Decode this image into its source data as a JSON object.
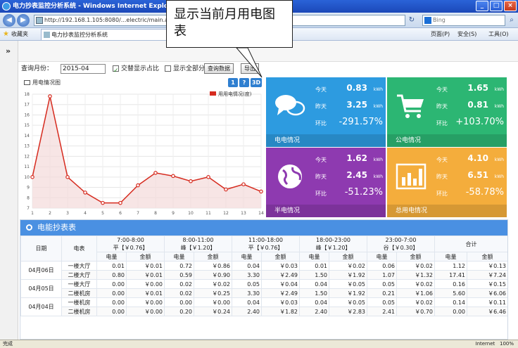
{
  "browser": {
    "title": "电力抄表监控分析系统 - Windows Internet Explorer",
    "address": "http://192.168.1.105:8080/...electric/main.aspx",
    "search_placeholder": "Bing",
    "favorites_label": "收藏夹",
    "tab_label": "电力抄表监控分析系统",
    "page_menu": "页面(P)",
    "safety_menu": "安全(S)",
    "tools_menu": "工具(O)",
    "status_left": "完成",
    "status_zone": "Internet",
    "zoom": "100%"
  },
  "callout": {
    "text": "显示当前月用电图表"
  },
  "toolbar": {
    "month_label": "查询月份：",
    "month_value": "2015-04",
    "chk1_label": "交替显示占比",
    "chk2_label": "显示全部分类",
    "query_button": "查询数据",
    "export_button": "导出"
  },
  "chart": {
    "title": "用电情况图",
    "btn1": "1",
    "btn2": "?",
    "btn3": "3D",
    "legend": "用用电情况(度)"
  },
  "chart_data": {
    "type": "line",
    "title": "用电情况图",
    "x": [
      1,
      2,
      3,
      4,
      5,
      6,
      7,
      8,
      9,
      10,
      11,
      12,
      13,
      14
    ],
    "series": [
      {
        "name": "用用电情况(度)",
        "values": [
          10,
          17.8,
          10,
          8.5,
          7.5,
          7.5,
          9.2,
          10.4,
          10.1,
          9.6,
          10,
          8.8,
          9.3,
          8.6
        ]
      }
    ],
    "ylim": [
      7,
      18
    ],
    "yticks": [
      7,
      8,
      9,
      10,
      11,
      12,
      13,
      14,
      15,
      16,
      17,
      18
    ],
    "grid": true,
    "legend_position": "top-right",
    "colors": {
      "line": "#d62b1f",
      "area": "#f3dada"
    }
  },
  "tiles": [
    {
      "name": "purchase",
      "color": "#2d9be0",
      "icon": "chat-bubbles-icon",
      "today_label": "今天",
      "today_value": "0.83",
      "unit": "kWh",
      "yesterday_label": "昨天",
      "yesterday_value": "3.25",
      "ratio_label": "环比",
      "ratio_value": "-291.57%",
      "footer": "电电情况"
    },
    {
      "name": "public",
      "color": "#2cb673",
      "icon": "shopping-cart-icon",
      "today_label": "今天",
      "today_value": "1.65",
      "unit": "kWh",
      "yesterday_label": "昨天",
      "yesterday_value": "0.81",
      "ratio_label": "环比",
      "ratio_value": "+103.70%",
      "footer": "公电情况"
    },
    {
      "name": "half-month",
      "color": "#8e3ab0",
      "icon": "globe-icon",
      "today_label": "今天",
      "today_value": "1.62",
      "unit": "kWh",
      "yesterday_label": "昨天",
      "yesterday_value": "2.45",
      "ratio_label": "环比",
      "ratio_value": "-51.23%",
      "footer": "半电情况"
    },
    {
      "name": "monthly",
      "color": "#f4ad3c",
      "icon": "bar-chart-icon",
      "today_label": "今天",
      "today_value": "4.10",
      "unit": "kWh",
      "yesterday_label": "昨天",
      "yesterday_value": "6.51",
      "ratio_label": "环比",
      "ratio_value": "-58.78%",
      "footer": "总用电情况"
    }
  ],
  "table": {
    "title": "电能抄表表",
    "col_date": "日期",
    "col_meter": "电表",
    "col_total": "合计",
    "periods": [
      {
        "time": "7:00-8:00",
        "rate": "平【￥0.76】"
      },
      {
        "time": "8:00-11:00",
        "rate": "峰【￥1.20】"
      },
      {
        "time": "11:00-18:00",
        "rate": "平【￥0.76】"
      },
      {
        "time": "18:00-23:00",
        "rate": "峰【￥1.20】"
      },
      {
        "time": "23:00-7:00",
        "rate": "谷【￥0.30】"
      }
    ],
    "sub_kwh": "电量",
    "sub_amt": "金额",
    "groups": [
      {
        "date": "04月06日",
        "rows": [
          {
            "meter": "一楼大厅",
            "cells": [
              "0.01",
              "￥0.01",
              "0.72",
              "￥0.86",
              "0.04",
              "￥0.03",
              "0.01",
              "￥0.02",
              "0.06",
              "￥0.02",
              "1.12",
              "￥0.13"
            ]
          },
          {
            "meter": "二楼大厅",
            "cells": [
              "0.80",
              "￥0.01",
              "0.59",
              "￥0.90",
              "3.30",
              "￥2.49",
              "1.50",
              "￥1.92",
              "1.07",
              "￥1.32",
              "17.41",
              "￥7.24"
            ]
          }
        ]
      },
      {
        "date": "04月05日",
        "rows": [
          {
            "meter": "一楼大厅",
            "cells": [
              "0.00",
              "￥0.00",
              "0.02",
              "￥0.02",
              "0.05",
              "￥0.04",
              "0.04",
              "￥0.05",
              "0.05",
              "￥0.02",
              "0.16",
              "￥0.15"
            ]
          },
          {
            "meter": "二楼机房",
            "cells": [
              "0.00",
              "￥0.01",
              "0.02",
              "￥0.25",
              "3.30",
              "￥2.49",
              "1.50",
              "￥1.92",
              "0.21",
              "￥1.06",
              "5.60",
              "￥6.06"
            ]
          }
        ]
      },
      {
        "date": "04月04日",
        "rows": [
          {
            "meter": "一楼机房",
            "cells": [
              "0.00",
              "￥0.00",
              "0.00",
              "￥0.00",
              "0.04",
              "￥0.03",
              "0.04",
              "￥0.05",
              "0.05",
              "￥0.02",
              "0.14",
              "￥0.11"
            ]
          },
          {
            "meter": "二楼机房",
            "cells": [
              "0.00",
              "￥0.00",
              "0.20",
              "￥0.24",
              "2.40",
              "￥1.82",
              "2.40",
              "￥2.83",
              "2.41",
              "￥0.70",
              "0.00",
              "￥6.46"
            ]
          }
        ]
      }
    ]
  }
}
